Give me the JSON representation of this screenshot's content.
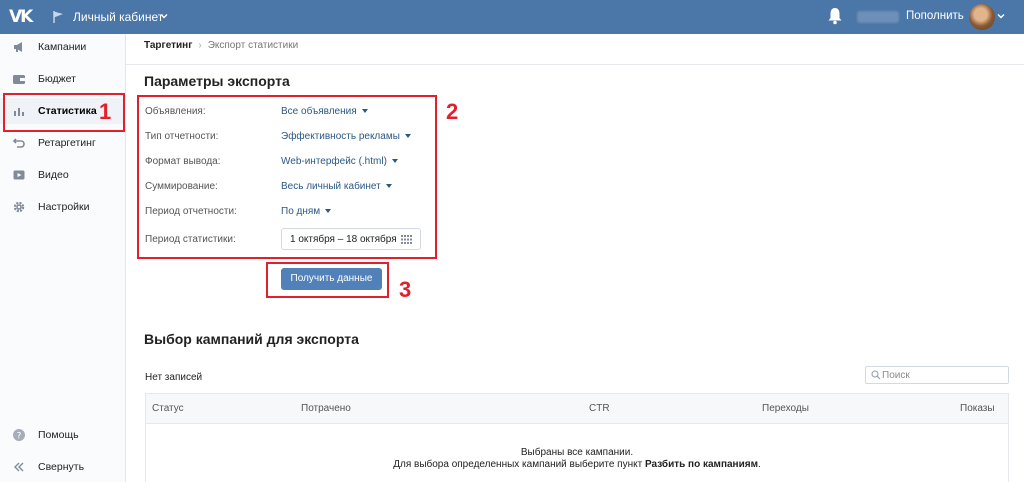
{
  "topbar": {
    "logo": "VK",
    "cabinet_label": "Личный кабинет",
    "balance_hidden": "",
    "refill_label": "Пополнить"
  },
  "sidebar": {
    "items": [
      {
        "label": "Кампании",
        "icon": "megaphone-icon"
      },
      {
        "label": "Бюджет",
        "icon": "wallet-icon"
      },
      {
        "label": "Статистика",
        "icon": "bar-chart-icon",
        "active": true
      },
      {
        "label": "Ретаргетинг",
        "icon": "retarget-icon"
      },
      {
        "label": "Видео",
        "icon": "video-icon"
      },
      {
        "label": "Настройки",
        "icon": "gear-icon"
      }
    ],
    "bottom": [
      {
        "label": "Помощь",
        "icon": "help-icon"
      },
      {
        "label": "Свернуть",
        "icon": "collapse-icon"
      }
    ]
  },
  "breadcrumb": {
    "root": "Таргетинг",
    "current": "Экспорт статистики"
  },
  "export_params": {
    "title": "Параметры экспорта",
    "fields": [
      {
        "label": "Объявления:",
        "value": "Все объявления"
      },
      {
        "label": "Тип отчетности:",
        "value": "Эффективность рекламы"
      },
      {
        "label": "Формат вывода:",
        "value": "Web-интерфейс (.html)"
      },
      {
        "label": "Суммирование:",
        "value": "Весь личный кабинет"
      },
      {
        "label": "Период отчетности:",
        "value": "По дням"
      },
      {
        "label": "Период статистики:",
        "value": "1 октября – 18 октября"
      }
    ],
    "submit_label": "Получить данные"
  },
  "campaigns": {
    "title": "Выбор кампаний для экспорта",
    "no_records": "Нет записей",
    "search_placeholder": "Поиск",
    "columns": [
      "Статус",
      "Потрачено",
      "CTR",
      "Переходы",
      "Показы"
    ],
    "empty_line1": "Выбраны все кампании.",
    "empty_line2_prefix": "Для выбора определенных кампаний выберите пункт ",
    "empty_line2_link": "Разбить по кампаниям",
    "empty_line2_suffix": "."
  },
  "annotations": {
    "marker1": "1",
    "marker2": "2",
    "marker3": "3",
    "color": "#e2202c"
  },
  "colors": {
    "brand": "#4a76a8",
    "button": "#5181b8",
    "link": "#2a5885"
  }
}
